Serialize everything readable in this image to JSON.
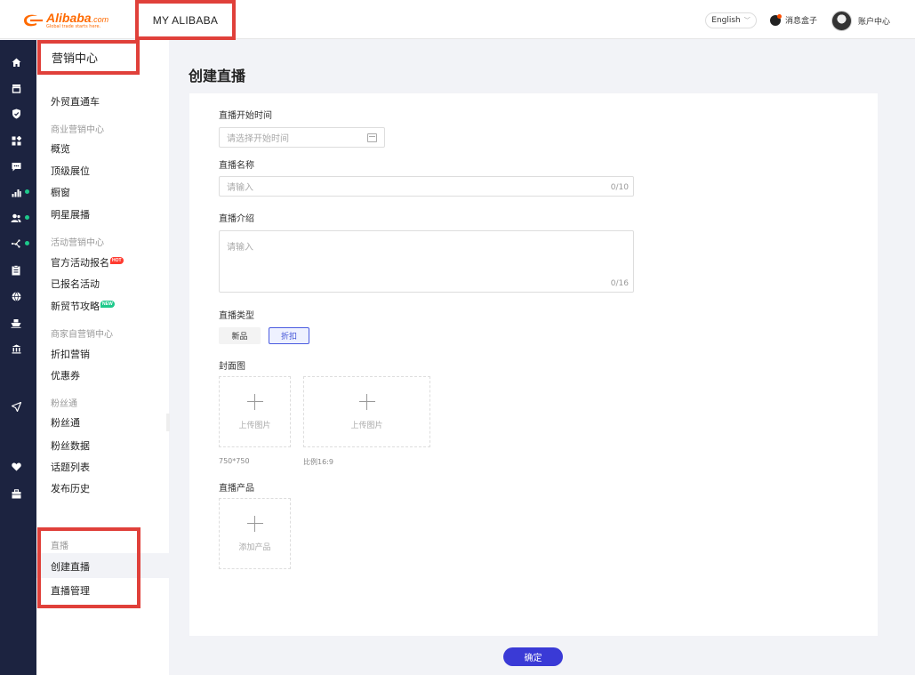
{
  "header": {
    "logo_word": "Alibaba",
    "logo_suffix": ".com",
    "logo_slogan": "Global trade starts here.",
    "nav_title": "MY ALIBABA",
    "language": "English",
    "message_box": "消息盒子",
    "account_center": "账户中心"
  },
  "iconbar": {
    "icons": [
      "home-icon",
      "store-icon",
      "shield-icon",
      "apps-icon",
      "chat-icon",
      "chart-icon",
      "users-icon",
      "marketing-icon",
      "clipboard-icon",
      "globe-icon",
      "ship-icon",
      "bank-icon",
      "send-icon",
      "heart-icon",
      "briefcase-icon"
    ]
  },
  "sidebar": {
    "title": "营销中心",
    "top_item": "外贸直通车",
    "groups": [
      {
        "label": "商业营销中心",
        "items": [
          "概览",
          "顶级展位",
          "橱窗",
          "明星展播"
        ]
      },
      {
        "label": "活动营销中心",
        "items": [
          "官方活动报名",
          "已报名活动",
          "新贸节攻略"
        ]
      },
      {
        "label": "商家自营销中心",
        "items": [
          "折扣营销",
          "优惠券"
        ]
      },
      {
        "label": "粉丝通",
        "items": [
          "粉丝通",
          "粉丝数据",
          "话题列表",
          "发布历史"
        ]
      },
      {
        "label": "直播",
        "items": [
          "创建直播",
          "直播管理"
        ]
      }
    ],
    "badge_hot": "HOT",
    "badge_new": "NEW"
  },
  "main": {
    "page_title": "创建直播",
    "form": {
      "start_time_label": "直播开始时间",
      "start_time_placeholder": "请选择开始时间",
      "name_label": "直播名称",
      "name_placeholder": "请输入",
      "name_counter": "0/10",
      "intro_label": "直播介绍",
      "intro_placeholder": "请输入",
      "intro_counter": "0/16",
      "type_label": "直播类型",
      "type_options": [
        "新品",
        "折扣"
      ],
      "type_selected": "折扣",
      "cover_label": "封面图",
      "cover_upload_text": "上传图片",
      "cover_hint_square": "750*750",
      "cover_hint_wide": "比例16:9",
      "product_label": "直播产品",
      "product_add_text": "添加产品"
    },
    "confirm_label": "确定"
  },
  "colors": {
    "brand": "#ff6a00",
    "highlight": "#e0403a",
    "iconbar": "#1c2340",
    "primary": "#3a3ad6",
    "status_dot": "#1ec98b"
  }
}
